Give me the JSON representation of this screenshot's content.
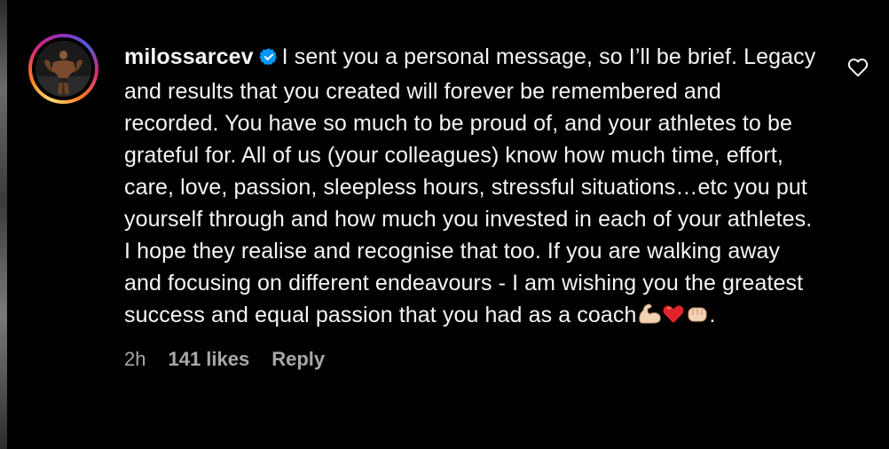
{
  "comment": {
    "username": "milossarcev",
    "verified_icon": "verified-badge-icon",
    "text": "I sent you a personal message, so I’ll be brief. Legacy and results that you created will forever be remembered and recorded. You have so much to be proud of, and your athletes to be grateful for. All of us (your colleagues) know how much time, effort, care, love, passion, sleepless hours, stressful situations…etc you put yourself through and how much you invested in each of your athletes. I hope they realise and recognise that too. If you are walking away and focusing on different endeavours - I am wishing you the greatest success and equal passion that you had as a coach",
    "text_end": ".",
    "emojis": [
      "flexed-biceps-emoji",
      "red-heart-emoji",
      "oncoming-fist-emoji"
    ],
    "time": "2h",
    "likes": "141 likes",
    "reply_label": "Reply",
    "like_icon": "heart-outline-icon"
  },
  "colors": {
    "background": "#000000",
    "text": "#f5f5f5",
    "meta": "#a8a8a8",
    "verified": "#0095f6"
  }
}
